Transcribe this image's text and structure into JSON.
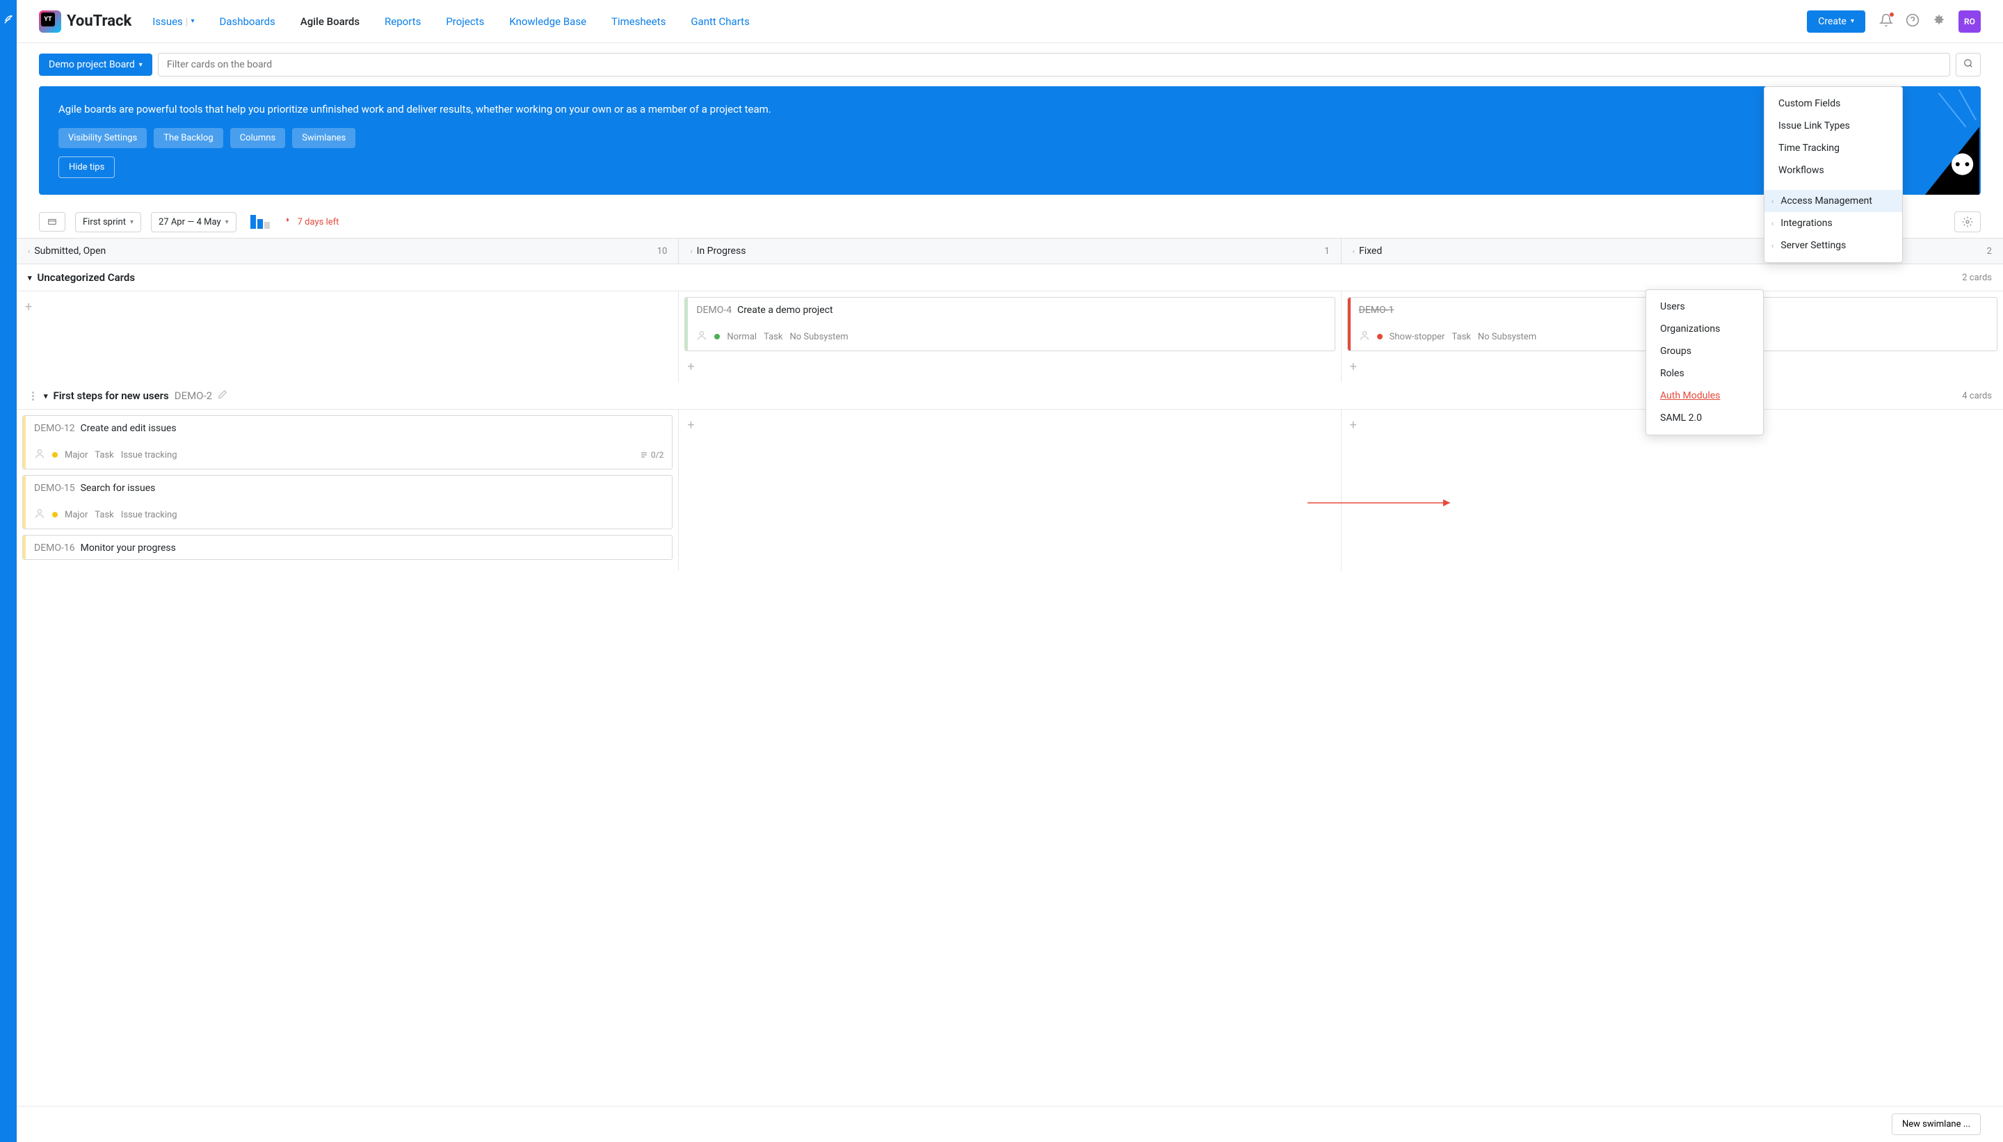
{
  "logo": "YouTrack",
  "nav": {
    "issues": "Issues",
    "dashboards": "Dashboards",
    "agile": "Agile Boards",
    "reports": "Reports",
    "projects": "Projects",
    "kb": "Knowledge Base",
    "timesheets": "Timesheets",
    "gantt": "Gantt Charts",
    "create": "Create"
  },
  "avatar": "RO",
  "toolbar": {
    "board": "Demo project Board",
    "filter_placeholder": "Filter cards on the board"
  },
  "tips": {
    "text": "Agile boards are powerful tools that help you prioritize unfinished work and deliver results, whether working on your own or as a member of a project team.",
    "b1": "Visibility Settings",
    "b2": "The Backlog",
    "b3": "Columns",
    "b4": "Swimlanes",
    "hide": "Hide tips"
  },
  "sprint": {
    "name": "First sprint",
    "dates": "27 Apr — 4 May",
    "days_left": "7 days left"
  },
  "columns": [
    {
      "name": "Submitted, Open",
      "count": "10"
    },
    {
      "name": "In Progress",
      "count": "1"
    },
    {
      "name": "Fixed",
      "count": "2"
    }
  ],
  "swimlanes": {
    "uncategorized": {
      "title": "Uncategorized Cards",
      "count": "2 cards",
      "cards_inprogress": {
        "id": "DEMO-4",
        "title": "Create a demo project",
        "priority": "Normal",
        "type": "Task",
        "subsystem": "No Subsystem"
      },
      "cards_fixed": {
        "id": "DEMO-1",
        "priority": "Show-stopper",
        "type": "Task",
        "subsystem": "No Subsystem"
      }
    },
    "first_steps": {
      "title": "First steps for new users",
      "sub": "DEMO-2",
      "count": "4 cards",
      "c1": {
        "id": "DEMO-12",
        "title": "Create and edit issues",
        "priority": "Major",
        "type": "Task",
        "subsystem": "Issue tracking",
        "tasks": "0/2"
      },
      "c2": {
        "id": "DEMO-15",
        "title": "Search for issues",
        "priority": "Major",
        "type": "Task",
        "subsystem": "Issue tracking"
      },
      "c3": {
        "id": "DEMO-16",
        "title": "Monitor your progress"
      }
    }
  },
  "menu1": {
    "i1": "Custom Fields",
    "i2": "Issue Link Types",
    "i3": "Time Tracking",
    "i4": "Workflows",
    "i5": "Access Management",
    "i6": "Integrations",
    "i7": "Server Settings"
  },
  "menu2": {
    "i1": "Users",
    "i2": "Organizations",
    "i3": "Groups",
    "i4": "Roles",
    "i5": "Auth Modules",
    "i6": "SAML 2.0"
  },
  "footer": {
    "new_swimlane": "New swimlane ..."
  }
}
